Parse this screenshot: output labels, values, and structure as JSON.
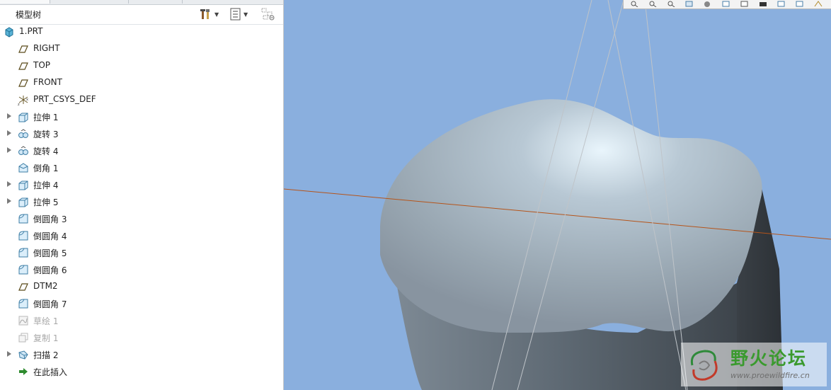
{
  "panel": {
    "title": "模型树",
    "header_icons": [
      "settings-icon",
      "tree-columns-icon",
      "tree-filter-icon"
    ]
  },
  "tree": {
    "items": [
      {
        "label": "1.PRT",
        "icon": "part-icon",
        "expandable": false,
        "suppressed": false
      },
      {
        "label": "RIGHT",
        "icon": "datum-plane-icon",
        "expandable": false,
        "suppressed": false
      },
      {
        "label": "TOP",
        "icon": "datum-plane-icon",
        "expandable": false,
        "suppressed": false
      },
      {
        "label": "FRONT",
        "icon": "datum-plane-icon",
        "expandable": false,
        "suppressed": false
      },
      {
        "label": "PRT_CSYS_DEF",
        "icon": "coordinate-system-icon",
        "expandable": false,
        "suppressed": false
      },
      {
        "label": "拉伸 1",
        "icon": "extrude-icon",
        "expandable": true,
        "suppressed": false
      },
      {
        "label": "旋转 3",
        "icon": "revolve-icon",
        "expandable": true,
        "suppressed": false
      },
      {
        "label": "旋转 4",
        "icon": "revolve-icon",
        "expandable": true,
        "suppressed": false
      },
      {
        "label": "倒角 1",
        "icon": "chamfer-icon",
        "expandable": false,
        "suppressed": false
      },
      {
        "label": "拉伸 4",
        "icon": "extrude-icon",
        "expandable": true,
        "suppressed": false
      },
      {
        "label": "拉伸 5",
        "icon": "extrude-icon",
        "expandable": true,
        "suppressed": false
      },
      {
        "label": "倒圆角 3",
        "icon": "round-icon",
        "expandable": false,
        "suppressed": false
      },
      {
        "label": "倒圆角 4",
        "icon": "round-icon",
        "expandable": false,
        "suppressed": false
      },
      {
        "label": "倒圆角 5",
        "icon": "round-icon",
        "expandable": false,
        "suppressed": false
      },
      {
        "label": "倒圆角 6",
        "icon": "round-icon",
        "expandable": false,
        "suppressed": false
      },
      {
        "label": "DTM2",
        "icon": "datum-plane-icon",
        "expandable": false,
        "suppressed": false
      },
      {
        "label": "倒圆角 7",
        "icon": "round-icon",
        "expandable": false,
        "suppressed": false
      },
      {
        "label": "草绘 1",
        "icon": "sketch-icon",
        "expandable": false,
        "suppressed": true
      },
      {
        "label": "复制 1",
        "icon": "copy-icon",
        "expandable": false,
        "suppressed": true
      },
      {
        "label": "扫描 2",
        "icon": "sweep-icon",
        "expandable": true,
        "suppressed": false
      },
      {
        "label": "在此插入",
        "icon": "insert-here-arrow-icon",
        "expandable": false,
        "suppressed": false
      }
    ]
  },
  "viewport": {
    "background_color": "#8aafde",
    "model_color": "#a3b0bb",
    "datum_line_color": "#b5541a"
  },
  "view_toolbar": {
    "icons": [
      "zoom-fit-icon",
      "zoom-in-icon",
      "zoom-out-icon",
      "repaint-icon",
      "display-style-icon",
      "saved-views-icon",
      "view-manager-icon",
      "datum-display-icon",
      "annotation-display-icon",
      "spin-center-icon",
      "more-tools-icon"
    ]
  },
  "watermark": {
    "title": "野火论坛",
    "url": "www.proewildfire.cn"
  }
}
